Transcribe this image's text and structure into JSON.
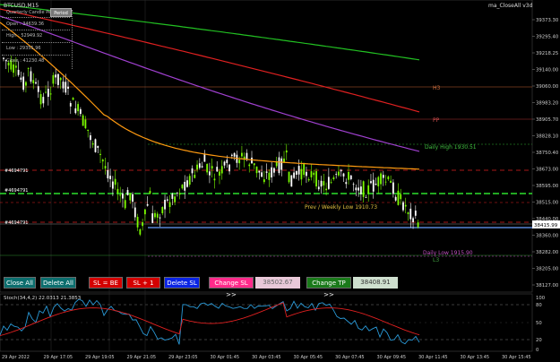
{
  "chart": {
    "symbol": "BTCUSD,M15",
    "indicator_name": "ma_CloseAll v3d",
    "lines": {
      "h3": "H3",
      "pp": "PP",
      "daily_high": "Daily High 1930.51",
      "weekly_low": "Prev / Weekly Low 1910.73",
      "daily_low": "Daily Low 1915.90",
      "l3": "L3"
    },
    "left_marks": [
      "#4694791",
      "#4694791",
      "#4694791"
    ],
    "current_price": "38415.99",
    "price_axis": [
      "39373.30",
      "39295.40",
      "39218.25",
      "39140.00",
      "39060.00",
      "38983.20",
      "38905.70",
      "38828.10",
      "38750.40",
      "38673.00",
      "38595.00",
      "38515.00",
      "38440.00",
      "38360.00",
      "38282.00",
      "38205.00",
      "38127.00"
    ],
    "time_axis": [
      "29 Apr 2022",
      "29 Apr 17:05",
      "29 Apr 19:05",
      "29 Apr 21:05",
      "29 Apr 23:05",
      "30 Apr 01:45",
      "30 Apr 03:45",
      "30 Apr 05:45",
      "30 Apr 07:45",
      "30 Apr 09:45",
      "30 Apr 11:45",
      "30 Apr 13:45",
      "30 Apr 15:45"
    ]
  },
  "ohlc_panel": {
    "title": "Quarterly Candle Period",
    "period_button": "Period",
    "open": "Open : 34639.36",
    "high": "High : 52949.92",
    "low": "Low : 29355.96",
    "close": "Close : 41230.48"
  },
  "buttons": {
    "close_all": "Close All",
    "delete_all": "Delete All",
    "sl_be": "SL = BE",
    "sl_plus": "SL + 1",
    "delete_sl": "Delete SL",
    "change_sl": "Change SL >>",
    "sl_value": "38502.67",
    "change_tp": "Change TP >>",
    "tp_value": "38408.91"
  },
  "stoch": {
    "label": "Stoch(34,4,2) 22.0313 21.3853",
    "axis": [
      "100",
      "80",
      "50",
      "20",
      "0"
    ]
  },
  "colors": {
    "background": "#000000",
    "bull": "#7cfc00",
    "bear": "#ffffff",
    "ma_green": "#22c022",
    "ma_red": "#e02020",
    "ma_purple": "#a040d0",
    "ma_orange": "#ff9a10",
    "close_button": "#0b6e6e",
    "sl_button": "#d40000",
    "delete_sl_button": "#0a24e6",
    "change_sl_button": "#ff2a8a",
    "change_tp_button": "#1a7a1a"
  }
}
